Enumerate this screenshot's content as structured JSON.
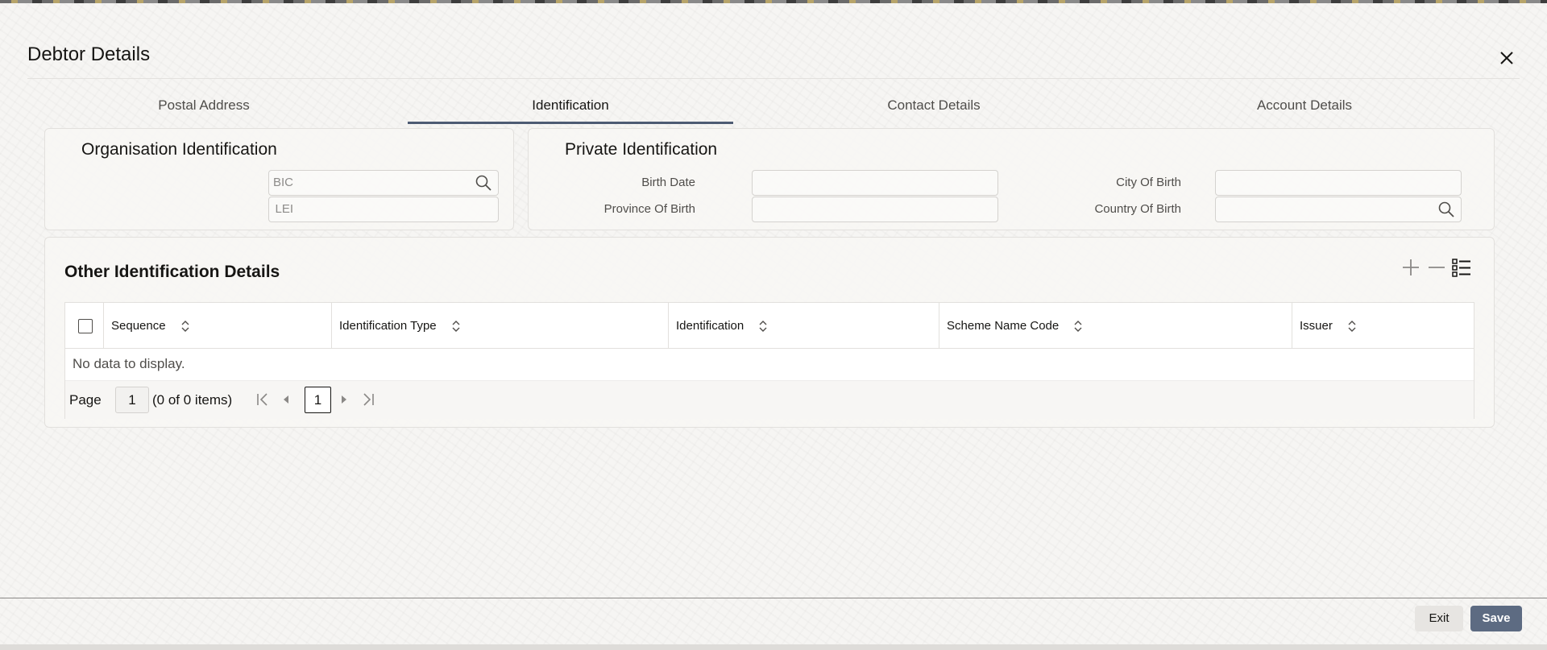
{
  "dialog": {
    "title": "Debtor Details",
    "close_icon": "close-icon"
  },
  "tabs": [
    {
      "label": "Postal Address",
      "active": false
    },
    {
      "label": "Identification",
      "active": true
    },
    {
      "label": "Contact Details",
      "active": false
    },
    {
      "label": "Account Details",
      "active": false
    }
  ],
  "org_identification": {
    "title": "Organisation Identification",
    "bic_label": "BIC",
    "bic_value": "",
    "lei_label": "LEI",
    "lei_value": ""
  },
  "private_identification": {
    "title": "Private Identification",
    "birth_date_label": "Birth Date",
    "birth_date_value": "",
    "province_label": "Province Of Birth",
    "province_value": "",
    "city_label": "City Of Birth",
    "city_value": "",
    "country_label": "Country Of Birth",
    "country_value": ""
  },
  "other_identification": {
    "title": "Other Identification Details",
    "add_icon": "plus-icon",
    "remove_icon": "minus-icon",
    "view_icon": "list-view-icon",
    "columns": [
      "Sequence",
      "Identification Type",
      "Identification",
      "Scheme Name Code",
      "Issuer"
    ],
    "empty_text": "No data to display.",
    "pager": {
      "page_label": "Page",
      "page_value": "1",
      "items_text": "(0 of 0 items)",
      "current_page": "1"
    }
  },
  "footer": {
    "exit_label": "Exit",
    "save_label": "Save"
  },
  "colors": {
    "accent": "#4d5b73",
    "save_button": "#5d6b82"
  }
}
